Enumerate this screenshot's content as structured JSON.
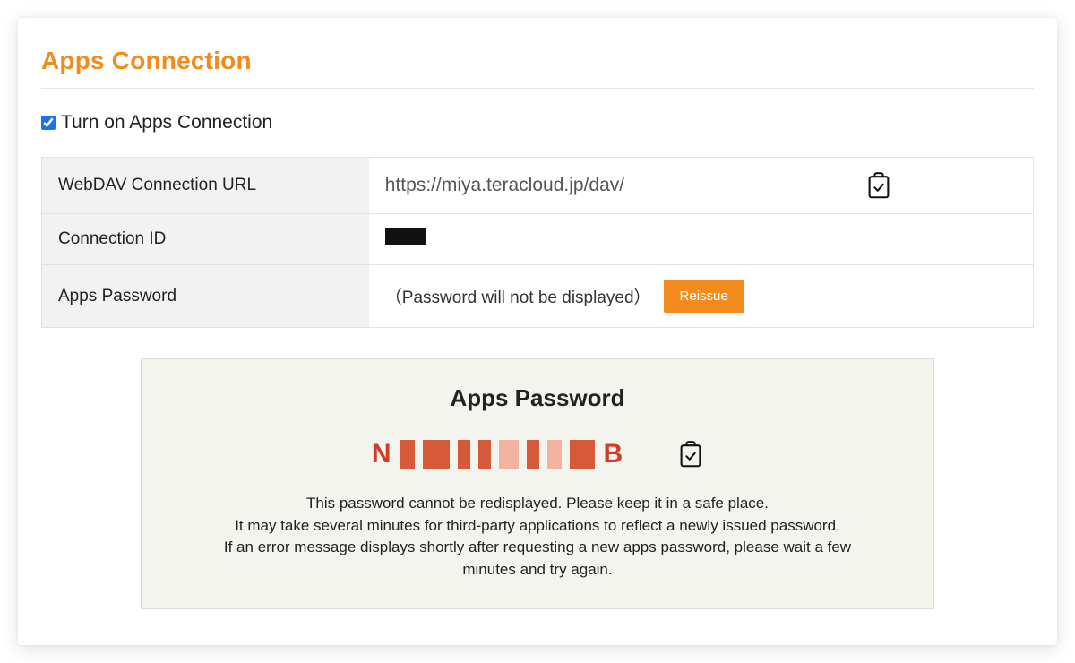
{
  "page": {
    "title": "Apps Connection",
    "toggle_label": "Turn on Apps Connection",
    "toggle_checked": true
  },
  "rows": {
    "webdav_label": "WebDAV Connection URL",
    "webdav_value": "https://miya.teracloud.jp/dav/",
    "connid_label": "Connection ID",
    "apps_pw_label": "Apps Password",
    "apps_pw_note": "（Password will not be displayed）",
    "reissue_label": "Reissue"
  },
  "panel": {
    "title": "Apps Password",
    "pw_first": "N",
    "pw_last": "B",
    "note1": "This password cannot be redisplayed. Please keep it in a safe place.",
    "note2": "It may take several minutes for third-party applications to reflect a newly issued password.",
    "note3": "If an error message displays shortly after requesting a new apps password, please wait a few minutes and try again."
  }
}
